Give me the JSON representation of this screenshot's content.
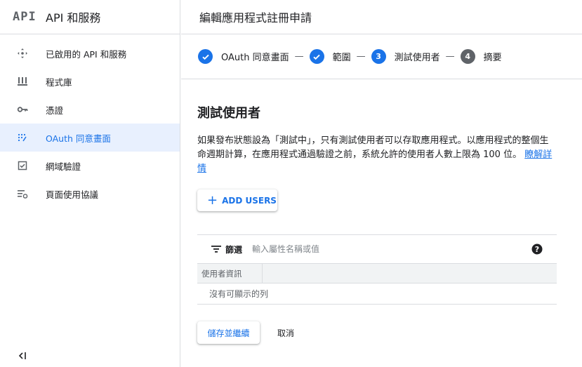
{
  "sidebar": {
    "logo": "API",
    "title": "API 和服務",
    "items": [
      {
        "label": "已啟用的 API 和服務",
        "icon": "diamond-arrows-icon",
        "active": false
      },
      {
        "label": "程式庫",
        "icon": "library-icon",
        "active": false
      },
      {
        "label": "憑證",
        "icon": "key-icon",
        "active": false
      },
      {
        "label": "OAuth 同意畫面",
        "icon": "dots-grid-icon",
        "active": true
      },
      {
        "label": "網域驗證",
        "icon": "checkbox-icon",
        "active": false
      },
      {
        "label": "頁面使用協議",
        "icon": "settings-list-icon",
        "active": false
      }
    ],
    "collapse_icon": "collapse-left-icon"
  },
  "header": {
    "title": "編輯應用程式註冊申請"
  },
  "stepper": {
    "steps": [
      {
        "label": "OAuth 同意畫面",
        "state": "done",
        "number": ""
      },
      {
        "label": "範圍",
        "state": "done",
        "number": ""
      },
      {
        "label": "測試使用者",
        "state": "current",
        "number": "3"
      },
      {
        "label": "摘要",
        "state": "todo",
        "number": "4"
      }
    ],
    "separator": "—"
  },
  "section": {
    "title": "測試使用者",
    "description": "如果發布狀態設為「測試中」，只有測試使用者可以存取應用程式。以應用程式的整個生命週期計算，在應用程式通過驗證之前，系統允許的使用者人數上限為 100 位。",
    "learn_more": "瞭解詳情"
  },
  "add_users_button": {
    "label": "ADD USERS"
  },
  "table": {
    "filter_label": "篩選",
    "filter_placeholder": "輸入屬性名稱或值",
    "columns": [
      "使用者資訊"
    ],
    "empty_text": "沒有可顯示的列"
  },
  "actions": {
    "save_label": "儲存並繼續",
    "cancel_label": "取消"
  },
  "colors": {
    "accent": "#1a73e8",
    "active_bg": "#e8f0fe",
    "border": "#dadce0",
    "muted": "#5f6368"
  }
}
